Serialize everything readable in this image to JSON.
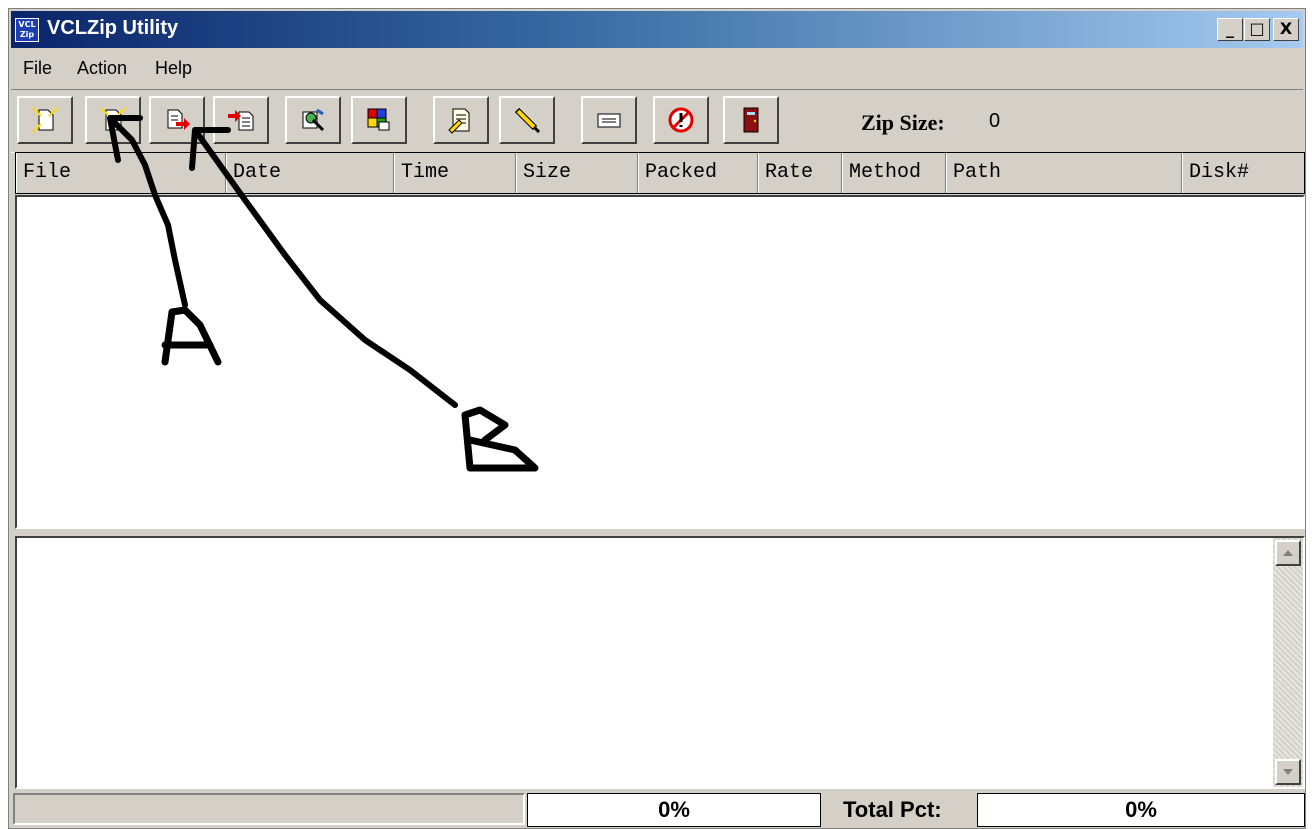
{
  "window": {
    "title": "VCLZip Utility",
    "icon_text": "VCL Zip",
    "minimize_glyph": "_",
    "maximize_glyph": "□",
    "close_glyph": "X"
  },
  "menu": [
    {
      "label": "File"
    },
    {
      "label": "Action"
    },
    {
      "label": "Help"
    }
  ],
  "toolbar": {
    "buttons": [
      {
        "icon": "new-archive-icon"
      },
      {
        "icon": "open-archive-icon"
      },
      {
        "icon": "zip-files-icon"
      },
      {
        "icon": "unzip-files-icon"
      },
      {
        "icon": "test-archive-icon"
      },
      {
        "icon": "view-file-icon"
      },
      {
        "icon": "comment-icon"
      },
      {
        "icon": "edit-pencil-icon"
      },
      {
        "icon": "console-icon"
      },
      {
        "icon": "cancel-icon"
      },
      {
        "icon": "exit-door-icon"
      }
    ],
    "zip_size_label": "Zip Size:",
    "zip_size_value": "0"
  },
  "columns": [
    "File",
    "Date",
    "Time",
    "Size",
    "Packed",
    "Rate",
    "Method",
    "Path",
    "Disk#"
  ],
  "annotations": {
    "label_a": "A",
    "label_b": "B"
  },
  "status": {
    "file_pct": "0%",
    "total_label": "Total Pct:",
    "total_pct": "0%"
  }
}
